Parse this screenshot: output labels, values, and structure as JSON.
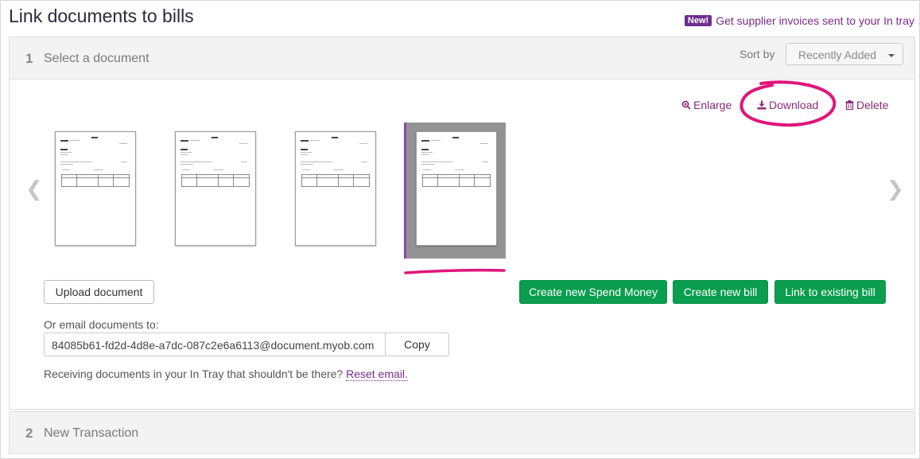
{
  "page": {
    "title": "Link documents to bills"
  },
  "promo": {
    "badge": "New!",
    "text": "Get supplier invoices sent to your In tray"
  },
  "step1": {
    "number": "1",
    "title": "Select a document",
    "sort_label": "Sort by",
    "sort_value": "Recently Added",
    "actions": {
      "enlarge": "Enlarge",
      "download": "Download",
      "delete": "Delete"
    },
    "thumbnail_count": 4,
    "selected_index": 4,
    "upload_label": "Upload document",
    "buttons": {
      "spend": "Create new Spend Money",
      "bill": "Create new bill",
      "link": "Link to existing bill"
    },
    "email_label": "Or email documents to:",
    "email_value": "84085b61-fd2d-4d8e-a7dc-087c2e6a6113@document.myob.com",
    "copy_label": "Copy",
    "receiving_text": "Receiving documents in your In Tray that shouldn't be there?",
    "reset_link": "Reset email."
  },
  "step2": {
    "number": "2",
    "title": "New Transaction"
  },
  "icons": {
    "enlarge": "magnifier-plus-icon",
    "download": "download-icon",
    "delete": "trash-icon",
    "prev": "chevron-left-icon",
    "next": "chevron-right-icon"
  },
  "colors": {
    "accent": "#8a2a7a",
    "primary_button": "#0a9e4e",
    "annotation": "#e0157a",
    "selected_frame": "#939393"
  }
}
